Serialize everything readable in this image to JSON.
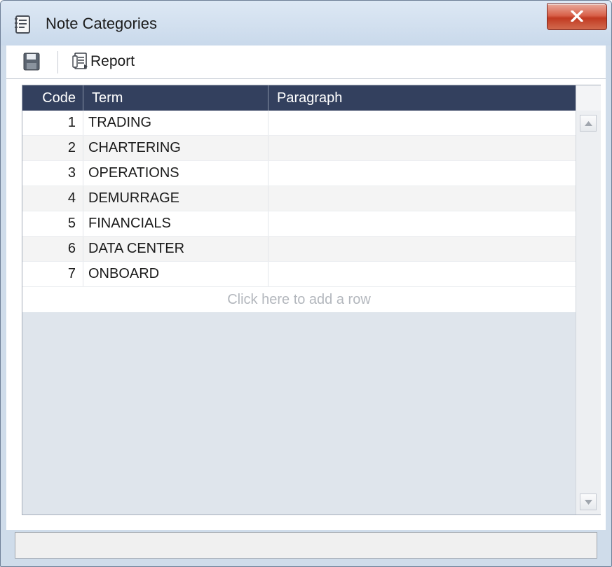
{
  "window": {
    "title": "Note Categories",
    "icons": {
      "title": "notes-document-icon",
      "close": "close-x-icon"
    }
  },
  "toolbar": {
    "report_label": "Report",
    "icons": {
      "save": "floppy-disk-icon",
      "report": "report-document-icon"
    }
  },
  "grid": {
    "columns": [
      "Code",
      "Term",
      "Paragraph"
    ],
    "rows": [
      {
        "code": "1",
        "term": "TRADING",
        "paragraph": ""
      },
      {
        "code": "2",
        "term": "CHARTERING",
        "paragraph": ""
      },
      {
        "code": "3",
        "term": "OPERATIONS",
        "paragraph": ""
      },
      {
        "code": "4",
        "term": "DEMURRAGE",
        "paragraph": ""
      },
      {
        "code": "5",
        "term": "FINANCIALS",
        "paragraph": ""
      },
      {
        "code": "6",
        "term": "DATA CENTER",
        "paragraph": ""
      },
      {
        "code": "7",
        "term": "ONBOARD",
        "paragraph": ""
      }
    ],
    "add_row_text": "Click here to add a row"
  },
  "colors": {
    "header_bg": "#33405e",
    "window_frame": "#cfdcea",
    "close_button": "#c13a22"
  }
}
